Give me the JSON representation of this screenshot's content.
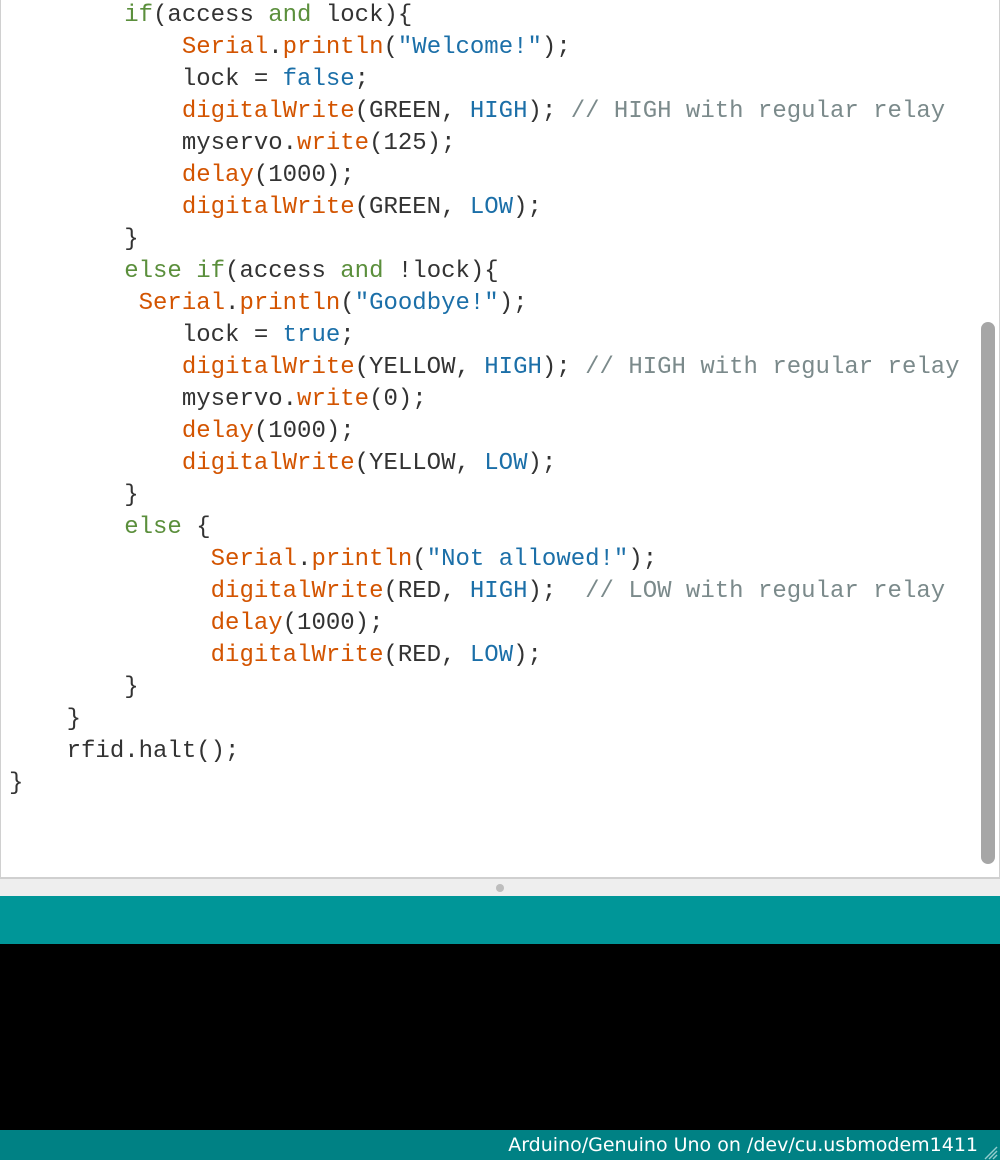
{
  "status": {
    "text": "Arduino/Genuino Uno on /dev/cu.usbmodem1411"
  },
  "code_lines": [
    {
      "indent": 8,
      "tokens": [
        {
          "t": "if",
          "c": "kw"
        },
        {
          "t": "(access ",
          "c": "def"
        },
        {
          "t": "and",
          "c": "kw"
        },
        {
          "t": " lock){",
          "c": "def"
        }
      ]
    },
    {
      "indent": 12,
      "tokens": [
        {
          "t": "Serial",
          "c": "ser"
        },
        {
          "t": ".",
          "c": "def"
        },
        {
          "t": "println",
          "c": "mem"
        },
        {
          "t": "(",
          "c": "def"
        },
        {
          "t": "\"Welcome!\"",
          "c": "str"
        },
        {
          "t": ");",
          "c": "def"
        }
      ]
    },
    {
      "indent": 12,
      "tokens": [
        {
          "t": "lock = ",
          "c": "def"
        },
        {
          "t": "false",
          "c": "con"
        },
        {
          "t": ";",
          "c": "def"
        }
      ]
    },
    {
      "indent": 12,
      "tokens": [
        {
          "t": "digitalWrite",
          "c": "mem"
        },
        {
          "t": "(GREEN, ",
          "c": "def"
        },
        {
          "t": "HIGH",
          "c": "con"
        },
        {
          "t": "); ",
          "c": "def"
        },
        {
          "t": "// HIGH with regular relay",
          "c": "cmt"
        }
      ]
    },
    {
      "indent": 12,
      "tokens": [
        {
          "t": "myservo.",
          "c": "def"
        },
        {
          "t": "write",
          "c": "mem"
        },
        {
          "t": "(125);",
          "c": "def"
        }
      ]
    },
    {
      "indent": 12,
      "tokens": [
        {
          "t": "delay",
          "c": "mem"
        },
        {
          "t": "(1000);",
          "c": "def"
        }
      ]
    },
    {
      "indent": 12,
      "tokens": [
        {
          "t": "digitalWrite",
          "c": "mem"
        },
        {
          "t": "(GREEN, ",
          "c": "def"
        },
        {
          "t": "LOW",
          "c": "con"
        },
        {
          "t": ");",
          "c": "def"
        }
      ]
    },
    {
      "indent": 8,
      "tokens": [
        {
          "t": "}",
          "c": "def"
        }
      ]
    },
    {
      "indent": 8,
      "tokens": [
        {
          "t": "else",
          "c": "kw"
        },
        {
          "t": " ",
          "c": "def"
        },
        {
          "t": "if",
          "c": "kw"
        },
        {
          "t": "(access ",
          "c": "def"
        },
        {
          "t": "and",
          "c": "kw"
        },
        {
          "t": " !lock){",
          "c": "def"
        }
      ]
    },
    {
      "indent": 9,
      "tokens": [
        {
          "t": "Serial",
          "c": "ser"
        },
        {
          "t": ".",
          "c": "def"
        },
        {
          "t": "println",
          "c": "mem"
        },
        {
          "t": "(",
          "c": "def"
        },
        {
          "t": "\"Goodbye!\"",
          "c": "str"
        },
        {
          "t": ");",
          "c": "def"
        }
      ]
    },
    {
      "indent": 12,
      "tokens": [
        {
          "t": "lock = ",
          "c": "def"
        },
        {
          "t": "true",
          "c": "con"
        },
        {
          "t": ";",
          "c": "def"
        }
      ]
    },
    {
      "indent": 12,
      "tokens": [
        {
          "t": "digitalWrite",
          "c": "mem"
        },
        {
          "t": "(YELLOW, ",
          "c": "def"
        },
        {
          "t": "HIGH",
          "c": "con"
        },
        {
          "t": "); ",
          "c": "def"
        },
        {
          "t": "// HIGH with regular relay",
          "c": "cmt"
        }
      ]
    },
    {
      "indent": 12,
      "tokens": [
        {
          "t": "myservo.",
          "c": "def"
        },
        {
          "t": "write",
          "c": "mem"
        },
        {
          "t": "(0);",
          "c": "def"
        }
      ]
    },
    {
      "indent": 12,
      "tokens": [
        {
          "t": "delay",
          "c": "mem"
        },
        {
          "t": "(1000);",
          "c": "def"
        }
      ]
    },
    {
      "indent": 12,
      "tokens": [
        {
          "t": "digitalWrite",
          "c": "mem"
        },
        {
          "t": "(YELLOW, ",
          "c": "def"
        },
        {
          "t": "LOW",
          "c": "con"
        },
        {
          "t": ");",
          "c": "def"
        }
      ]
    },
    {
      "indent": 8,
      "tokens": [
        {
          "t": "}",
          "c": "def"
        }
      ]
    },
    {
      "indent": 8,
      "tokens": [
        {
          "t": "else",
          "c": "kw"
        },
        {
          "t": " {",
          "c": "def"
        }
      ]
    },
    {
      "indent": 14,
      "tokens": [
        {
          "t": "Serial",
          "c": "ser"
        },
        {
          "t": ".",
          "c": "def"
        },
        {
          "t": "println",
          "c": "mem"
        },
        {
          "t": "(",
          "c": "def"
        },
        {
          "t": "\"Not allowed!\"",
          "c": "str"
        },
        {
          "t": ");",
          "c": "def"
        }
      ]
    },
    {
      "indent": 14,
      "tokens": [
        {
          "t": "digitalWrite",
          "c": "mem"
        },
        {
          "t": "(RED, ",
          "c": "def"
        },
        {
          "t": "HIGH",
          "c": "con"
        },
        {
          "t": ");  ",
          "c": "def"
        },
        {
          "t": "// LOW with regular relay",
          "c": "cmt"
        }
      ]
    },
    {
      "indent": 14,
      "tokens": [
        {
          "t": "delay",
          "c": "mem"
        },
        {
          "t": "(1000);",
          "c": "def"
        }
      ]
    },
    {
      "indent": 14,
      "tokens": [
        {
          "t": "digitalWrite",
          "c": "mem"
        },
        {
          "t": "(RED, ",
          "c": "def"
        },
        {
          "t": "LOW",
          "c": "con"
        },
        {
          "t": ");",
          "c": "def"
        }
      ]
    },
    {
      "indent": 8,
      "tokens": [
        {
          "t": "}",
          "c": "def"
        }
      ]
    },
    {
      "indent": 4,
      "tokens": [
        {
          "t": "}",
          "c": "def"
        }
      ]
    },
    {
      "indent": 0,
      "tokens": [
        {
          "t": "",
          "c": "def"
        }
      ]
    },
    {
      "indent": 4,
      "tokens": [
        {
          "t": "rfid.halt();",
          "c": "def"
        }
      ]
    },
    {
      "indent": 0,
      "tokens": [
        {
          "t": "",
          "c": "def"
        }
      ]
    },
    {
      "indent": 0,
      "tokens": [
        {
          "t": "}",
          "c": "def"
        }
      ]
    }
  ]
}
